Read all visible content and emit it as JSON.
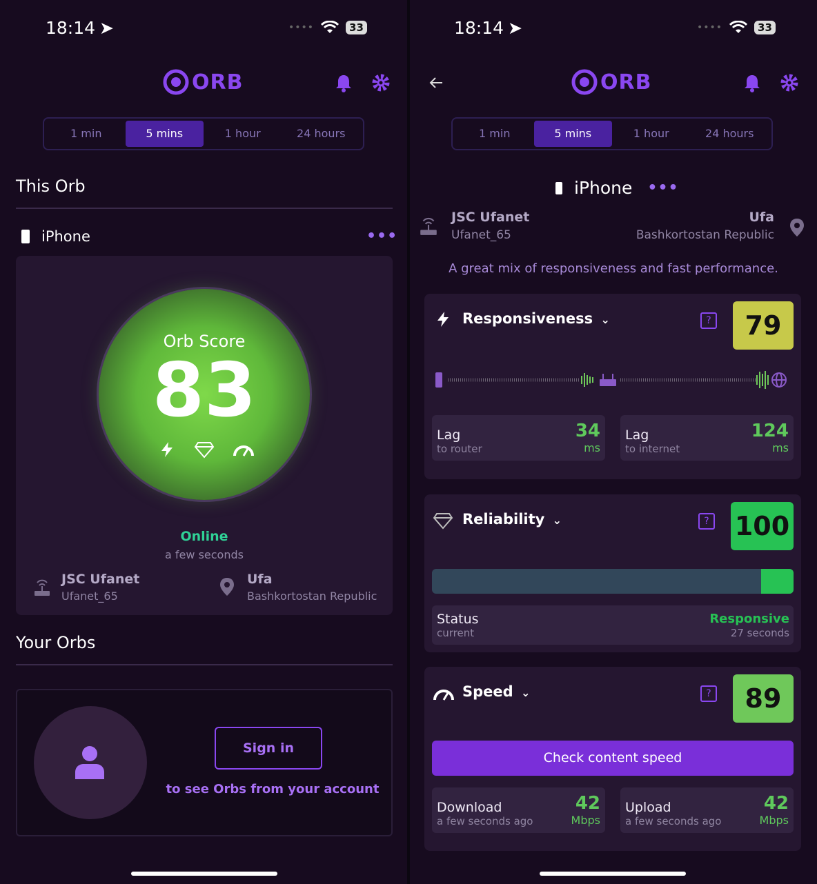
{
  "status_bar": {
    "time": "18:14",
    "battery": "33"
  },
  "brand": {
    "name": "ORB"
  },
  "time_tabs": [
    "1 min",
    "5 mins",
    "1 hour",
    "24 hours"
  ],
  "left": {
    "this_orb_title": "This Orb",
    "device": {
      "name": "iPhone",
      "more": "•••"
    },
    "orb_score": {
      "label": "Orb Score",
      "value": "83"
    },
    "status": "Online",
    "status_time": "a few seconds",
    "isp": {
      "name": "JSC Ufanet",
      "network": "Ufanet_65"
    },
    "location": {
      "city": "Ufa",
      "region": "Bashkortostan Republic"
    },
    "your_orbs_title": "Your Orbs",
    "sign_in_label": "Sign in",
    "sign_in_caption": "to see Orbs from your account"
  },
  "right": {
    "device": {
      "name": "iPhone",
      "more": "•••"
    },
    "isp": {
      "name": "JSC Ufanet",
      "network": "Ufanet_65"
    },
    "location": {
      "city": "Ufa",
      "region": "Bashkortostan Republic"
    },
    "summary": "A great mix of responsiveness and fast performance.",
    "responsiveness": {
      "title": "Responsiveness",
      "score": "79",
      "score_color": "#c7c94a",
      "lag_router": {
        "label": "Lag",
        "sub": "to router",
        "value": "34",
        "unit": "ms"
      },
      "lag_internet": {
        "label": "Lag",
        "sub": "to internet",
        "value": "124",
        "unit": "ms"
      }
    },
    "reliability": {
      "title": "Reliability",
      "score": "100",
      "score_color": "#27c254",
      "bar_fill_fraction": 0.09,
      "status_label": "Status",
      "status_sub": "current",
      "status_value": "Responsive",
      "status_time": "27 seconds"
    },
    "speed": {
      "title": "Speed",
      "score": "89",
      "score_color": "#6fc85a",
      "check_button": "Check content speed",
      "download": {
        "label": "Download",
        "sub": "a few seconds ago",
        "value": "42",
        "unit": "Mbps"
      },
      "upload": {
        "label": "Upload",
        "sub": "a few seconds ago",
        "value": "42",
        "unit": "Mbps"
      }
    }
  },
  "colors": {
    "accent": "#8a47f0",
    "bg": "#170b1f",
    "card": "#251630",
    "green": "#5fc95c",
    "online": "#2fd196"
  }
}
